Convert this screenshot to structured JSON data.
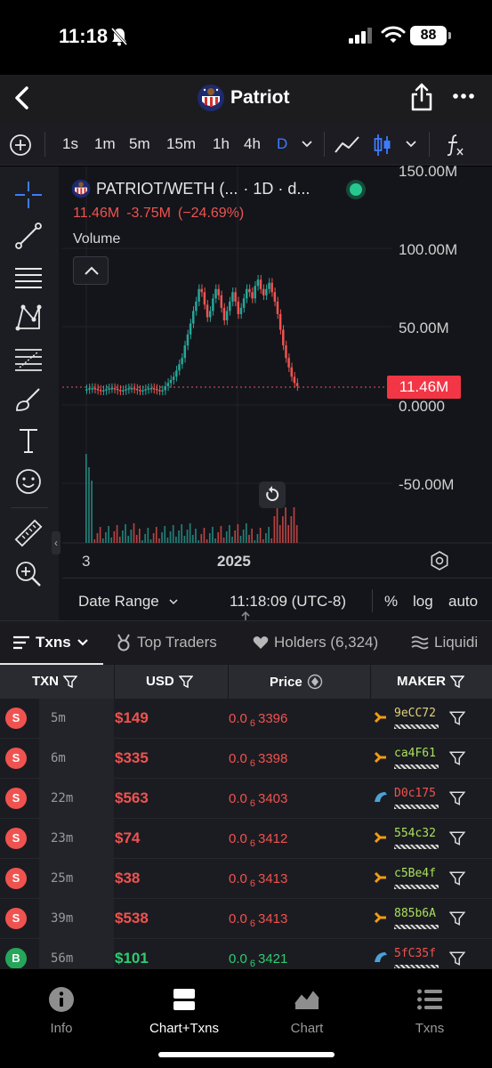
{
  "status": {
    "time": "11:18",
    "battery": "88"
  },
  "header": {
    "title": "Patriot"
  },
  "timeframes": [
    "1s",
    "1m",
    "5m",
    "15m",
    "1h",
    "4h",
    "D"
  ],
  "active_timeframe": "D",
  "chart": {
    "pair": "PATRIOT/WETH (...",
    "interval": "· 1D · d...",
    "last_value": "11.46M",
    "change": "-3.75M",
    "change_pct": "(−24.69%)",
    "volume_label": "Volume",
    "y_labels": [
      "150.00M",
      "100.00M",
      "50.00M",
      "0.0000",
      "-50.00M"
    ],
    "price_tag": "11.46M",
    "x_labels": [
      "3",
      "2025"
    ],
    "date_range": "Date Range",
    "clock": "11:18:09 (UTC-8)",
    "opts": [
      "%",
      "log",
      "auto"
    ],
    "colors": {
      "up": "#26a69a",
      "down": "#ef5350",
      "accent": "#3d7bff"
    }
  },
  "tabs": [
    {
      "label": "Txns"
    },
    {
      "label": "Top Traders"
    },
    {
      "label": "Holders (6,324)"
    },
    {
      "label": "Liquidi"
    }
  ],
  "table": {
    "headers": {
      "txn": "TXN",
      "usd": "USD",
      "price": "Price",
      "maker": "MAKER"
    },
    "rows": [
      {
        "type": "S",
        "age": "5m",
        "usd": "$149",
        "price_pre": "0.0",
        "price_sub": "6",
        "price_post": "3396",
        "maker": "9eCC72",
        "maker_color": "#e0d27a"
      },
      {
        "type": "S",
        "age": "6m",
        "usd": "$335",
        "price_pre": "0.0",
        "price_sub": "6",
        "price_post": "3398",
        "maker": "ca4F61",
        "maker_color": "#a8e05a"
      },
      {
        "type": "S",
        "age": "22m",
        "usd": "$563",
        "price_pre": "0.0",
        "price_sub": "6",
        "price_post": "3403",
        "maker": "D0c175",
        "maker_color": "#ef5350"
      },
      {
        "type": "S",
        "age": "23m",
        "usd": "$74",
        "price_pre": "0.0",
        "price_sub": "6",
        "price_post": "3412",
        "maker": "554c32",
        "maker_color": "#a8e05a"
      },
      {
        "type": "S",
        "age": "25m",
        "usd": "$38",
        "price_pre": "0.0",
        "price_sub": "6",
        "price_post": "3413",
        "maker": "c5Be4f",
        "maker_color": "#a8e05a"
      },
      {
        "type": "S",
        "age": "39m",
        "usd": "$538",
        "price_pre": "0.0",
        "price_sub": "6",
        "price_post": "3413",
        "maker": "885b6A",
        "maker_color": "#a8e05a"
      },
      {
        "type": "B",
        "age": "56m",
        "usd": "$101",
        "price_pre": "0.0",
        "price_sub": "6",
        "price_post": "3421",
        "maker": "5fC35f",
        "maker_color": "#ef5350"
      }
    ]
  },
  "bottom_nav": [
    {
      "label": "Info"
    },
    {
      "label": "Chart+Txns"
    },
    {
      "label": "Chart"
    },
    {
      "label": "Txns"
    }
  ]
}
